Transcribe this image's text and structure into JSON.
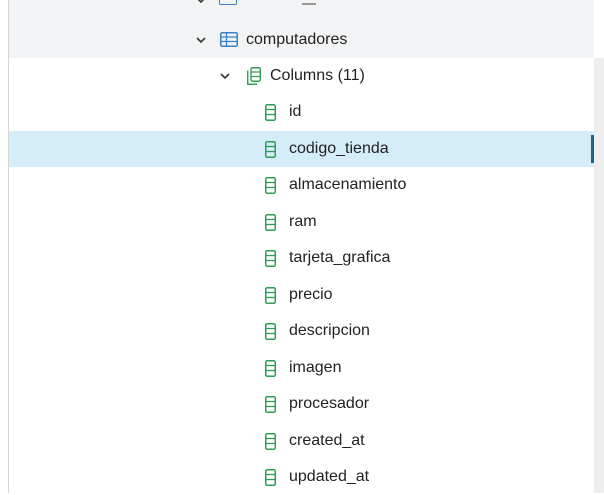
{
  "tree": {
    "table": {
      "label": "computadores",
      "icon": "table-icon",
      "expanded": true
    },
    "columns_folder": {
      "label": "Columns",
      "count": "(11)",
      "icon": "columns-icon",
      "expanded": true
    },
    "columns": [
      {
        "label": "id"
      },
      {
        "label": "codigo_tienda",
        "selected": true
      },
      {
        "label": "almacenamiento"
      },
      {
        "label": "ram"
      },
      {
        "label": "tarjeta_grafica"
      },
      {
        "label": "precio"
      },
      {
        "label": "descripcion"
      },
      {
        "label": "imagen"
      },
      {
        "label": "procesador"
      },
      {
        "label": "created_at"
      },
      {
        "label": "updated_at"
      }
    ]
  },
  "colors": {
    "selection": "#d5ecf9",
    "selection_marker": "#2a5d8a",
    "icon_green": "#2e9e55",
    "icon_blue": "#3b82c4"
  }
}
